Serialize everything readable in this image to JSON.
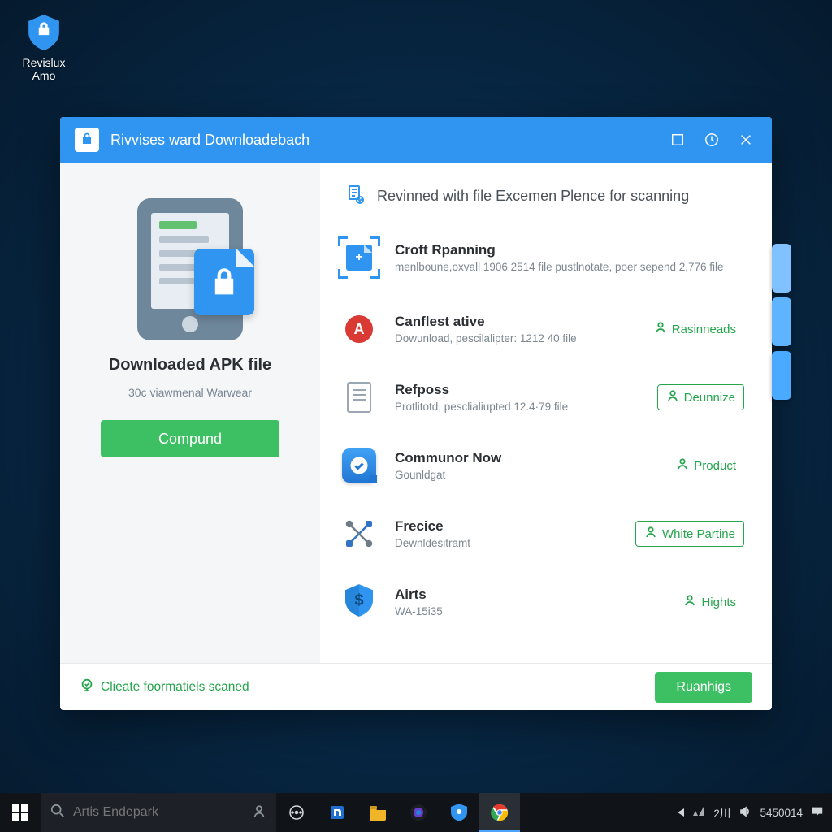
{
  "desktop": {
    "icon_label": "Revislux Amo"
  },
  "window": {
    "title": "Rivvises ward Downloadebach",
    "side": {
      "title": "Downloaded APK file",
      "subtitle": "30c viawmenal Warwear",
      "button": "Compund"
    },
    "heading": "Revinned with file Excemen Plence for scanning",
    "items": [
      {
        "icon": "scan-document-icon",
        "title": "Croft Rpanning",
        "desc": "menlboune,oxvall 1906 2514 file pustlnotate, poer sepend 2,776 file",
        "action": null,
        "boxed": false
      },
      {
        "icon": "red-a-icon",
        "title": "Canflest ative",
        "desc": "Dowunload, pescіlalipter: 1212 40 file",
        "action": "Rasinneads",
        "boxed": false
      },
      {
        "icon": "document-mini-icon",
        "title": "Refposs",
        "desc": "Protlitotd, pesclialiupted 12.4·79 file",
        "action": "Deunnize",
        "boxed": true
      },
      {
        "icon": "blue-check-icon",
        "title": "Communor Now",
        "desc": "Gounldgat",
        "action": "Product",
        "boxed": false
      },
      {
        "icon": "tools-cross-icon",
        "title": "Frecice",
        "desc": "Dewnldesitramt",
        "action": "White Partine",
        "boxed": true
      },
      {
        "icon": "shield-icon",
        "title": "Airts",
        "desc": "WA-15i35",
        "action": "Hights",
        "boxed": false
      }
    ],
    "footer": {
      "status": "Clieate foormatiels scaned",
      "run": "Ruanhigs"
    }
  },
  "taskbar": {
    "search_placeholder": "Artis Endepark",
    "clock": "5450014",
    "tray_text": "2川"
  },
  "colors": {
    "accent": "#2f95f0",
    "green": "#3dbf63",
    "green_text": "#25a54c",
    "red": "#d93a34"
  }
}
